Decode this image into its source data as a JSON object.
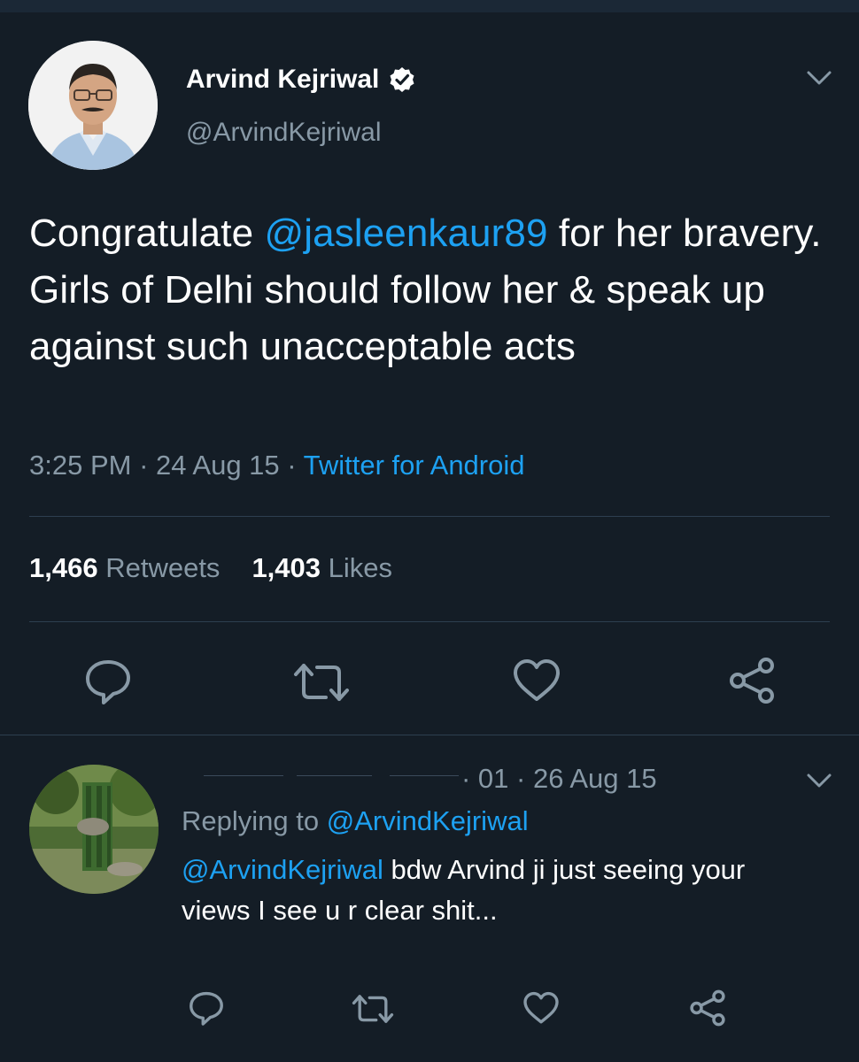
{
  "main_tweet": {
    "author": {
      "display_name": "Arvind Kejriwal",
      "handle": "@ArvindKejriwal",
      "verified": true
    },
    "text": {
      "prefix": "Congratulate ",
      "mention": "@jasleenkaur89",
      "suffix": " for her bravery. Girls of Delhi should follow her & speak up against such unacceptable acts"
    },
    "meta": {
      "time": "3:25 PM",
      "separator": " · ",
      "date": "24 Aug 15",
      "source": "Twitter for Android"
    },
    "stats": {
      "retweets_count": "1,466",
      "retweets_label": "Retweets",
      "likes_count": "1,403",
      "likes_label": "Likes"
    },
    "actions": [
      "reply-icon",
      "retweet-icon",
      "like-icon",
      "share-icon"
    ]
  },
  "reply_tweet": {
    "meta": "· 01 · 26 Aug 15",
    "replying_label": "Replying to ",
    "replying_to": "@ArvindKejriwal",
    "text_mention": "@ArvindKejriwal",
    "text_body": " bdw Arvind ji just seeing your views I see u r clear shit...",
    "actions": [
      "reply-icon",
      "retweet-icon",
      "like-icon",
      "share-icon"
    ]
  },
  "colors": {
    "background": "#141d26",
    "accent": "#1da1f2",
    "secondary_text": "#8899a6",
    "divider": "#2d3f50"
  }
}
